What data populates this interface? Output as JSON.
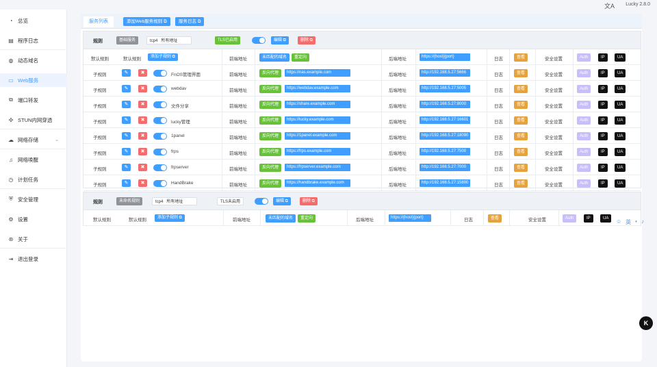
{
  "header": {
    "version": "Lucky 2.8.0",
    "translate_icon": "translate-icon"
  },
  "sidebar": {
    "items": [
      {
        "label": "总览",
        "icon": "dashboard-icon"
      },
      {
        "label": "程序日志",
        "icon": "log-icon"
      },
      {
        "label": "动态域名",
        "icon": "globe-icon"
      },
      {
        "label": "Web服务",
        "icon": "server-icon"
      },
      {
        "label": "端口转发",
        "icon": "port-icon"
      },
      {
        "label": "STUN内网穿透",
        "icon": "stun-icon"
      },
      {
        "label": "网络存储",
        "icon": "cloud-icon"
      },
      {
        "label": "网络唤醒",
        "icon": "bell-icon"
      },
      {
        "label": "计划任务",
        "icon": "clock-icon"
      },
      {
        "label": "安全管理",
        "icon": "shield-icon"
      },
      {
        "label": "设置",
        "icon": "gear-icon"
      },
      {
        "label": "关于",
        "icon": "info-icon"
      },
      {
        "label": "退出登录",
        "icon": "logout-icon"
      }
    ]
  },
  "tabs": {
    "list": "服务列表",
    "add_rule": "添加Web服务规则",
    "log": "服务日志"
  },
  "common": {
    "rule": "规则",
    "default_rule": "默认规则",
    "sub_rule": "子规则",
    "add_sub_rule": "添加子规则",
    "frontend": "前端地址",
    "backend": "后端地址",
    "log": "日志",
    "view": "查看",
    "security": "安全设置",
    "auth": "Auth",
    "ip": "IP",
    "ua": "UA",
    "on": "开",
    "edit": "编辑",
    "delete": "删除",
    "unmatched": "未匹配的域名",
    "redirect": "重定向",
    "reverse_proxy": "反向代理"
  },
  "rule1": {
    "name": "基础服务",
    "proto": "tcp4",
    "addr": "所有地址",
    "tls": "TLS已启用",
    "default_backend": "https://{host}{port}",
    "subs": [
      {
        "name": "FnOS管理界面",
        "frontend": "https://nas.example.com",
        "backend": "http://192.168.5.27:5666"
      },
      {
        "name": "webdav",
        "frontend": "https://webdav.example.com",
        "backend": "http://192.168.5.27:5005"
      },
      {
        "name": "文件分享",
        "frontend": "https://share.example.com",
        "backend": "http://192.168.5.27:8000"
      },
      {
        "name": "lucky管理",
        "frontend": "https://lucky.example.com",
        "backend": "http://192.168.5.27:16601"
      },
      {
        "name": "1panel",
        "frontend": "https://1panel.example.com",
        "backend": "http://192.168.5.27:18090"
      },
      {
        "name": "frps",
        "frontend": "https://frps.example.com",
        "backend": "http://192.168.5.27:7500"
      },
      {
        "name": "frpserver",
        "frontend": "https://frpserver.example.com",
        "backend": "http://192.168.5.27:7000"
      },
      {
        "name": "HandBrake",
        "frontend": "https://handbrake.example.com",
        "backend": "http://192.168.5.27:15800"
      }
    ]
  },
  "rule2": {
    "name": "未命名规则",
    "proto": "tcp4",
    "addr": "所有地址",
    "tls": "TLS未启用",
    "default_backend": "https://{host}{port}"
  }
}
